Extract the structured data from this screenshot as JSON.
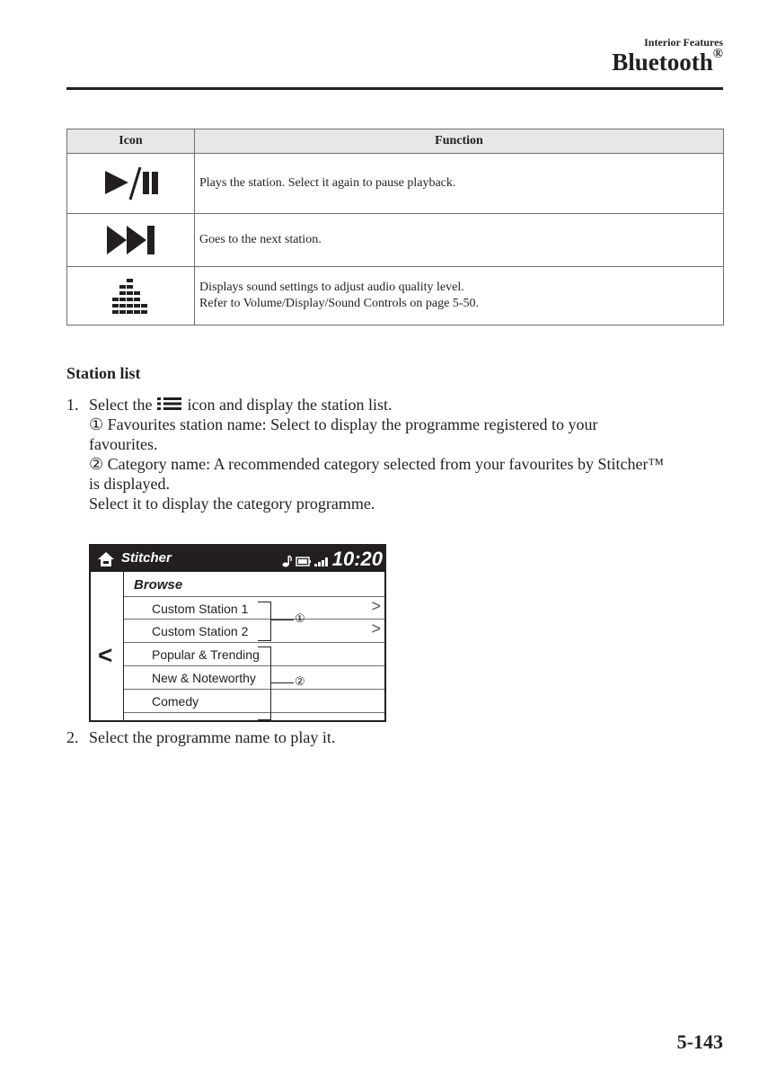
{
  "header": {
    "section": "Interior Features",
    "title": "Bluetooth",
    "title_mark": "®"
  },
  "icon_table": {
    "headers": [
      "Icon",
      "Function"
    ],
    "rows": [
      {
        "icon": "play-pause-icon",
        "lines": [
          "Plays the station. Select it again to pause playback."
        ]
      },
      {
        "icon": "next-track-icon",
        "lines": [
          "Goes to the next station."
        ]
      },
      {
        "icon": "sound-settings-icon",
        "lines": [
          "Displays sound settings to adjust audio quality level.",
          "Refer to Volume/Display/Sound Controls on page 5-50."
        ]
      }
    ]
  },
  "station_list": {
    "heading": "Station list",
    "step1": {
      "num": "1.",
      "pre": "Select the",
      "icon": "list-icon",
      "post": "icon and display the station list.",
      "note1_marker": "①",
      "note1_line1": "Favourites station name: Select to display the programme registered to your",
      "note1_line2": "favourites.",
      "note2_marker": "②",
      "note2_line1": "Category name: A recommended category selected from your favourites by Stitcher™",
      "note2_line2": "is displayed.",
      "note3": "Select it to display the category programme."
    },
    "step2": {
      "num": "2.",
      "text": "Select the programme name to play it."
    }
  },
  "screen": {
    "app_name": "Stitcher",
    "time": "10:20",
    "status_icons": [
      "music-note-icon",
      "battery-icon",
      "signal-icon"
    ],
    "title": "Browse",
    "items": [
      {
        "label": "Custom Station 1",
        "chevron": ">"
      },
      {
        "label": "Custom Station 2",
        "chevron": ">"
      },
      {
        "label": "Popular & Trending",
        "chevron": ""
      },
      {
        "label": "New & Noteworthy",
        "chevron": ""
      },
      {
        "label": "Comedy",
        "chevron": ""
      }
    ],
    "back_glyph": "<",
    "callout1": "①",
    "callout2": "②"
  },
  "page_number": "5-143"
}
